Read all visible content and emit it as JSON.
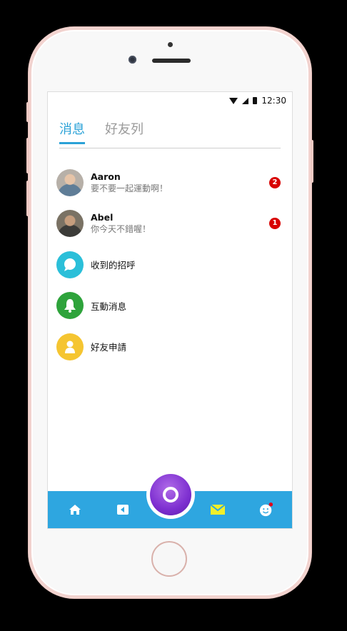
{
  "status_bar": {
    "time": "12:30"
  },
  "tabs": [
    {
      "label": "消息",
      "active": true
    },
    {
      "label": "好友列",
      "active": false
    }
  ],
  "messages": [
    {
      "name": "Aaron",
      "preview": "要不要一起運動啊！",
      "unread": "2"
    },
    {
      "name": "Abel",
      "preview": "你今天不錯喔！",
      "unread": "1"
    }
  ],
  "categories": [
    {
      "label": "收到的招呼",
      "icon": "chat-bubble-icon",
      "color": "#2bbfd9"
    },
    {
      "label": "互動消息",
      "icon": "bell-icon",
      "color": "#2ea33b"
    },
    {
      "label": "好友申請",
      "icon": "person-icon",
      "color": "#f5c531"
    }
  ],
  "colors": {
    "accent": "#2ba2d7",
    "nav_bar": "#2ea6e0",
    "badge": "#d80000",
    "fab": "#7d2fd0"
  },
  "bottom_nav": {
    "items": [
      "home-icon",
      "back-icon",
      "mail-icon",
      "smiley-icon"
    ]
  }
}
